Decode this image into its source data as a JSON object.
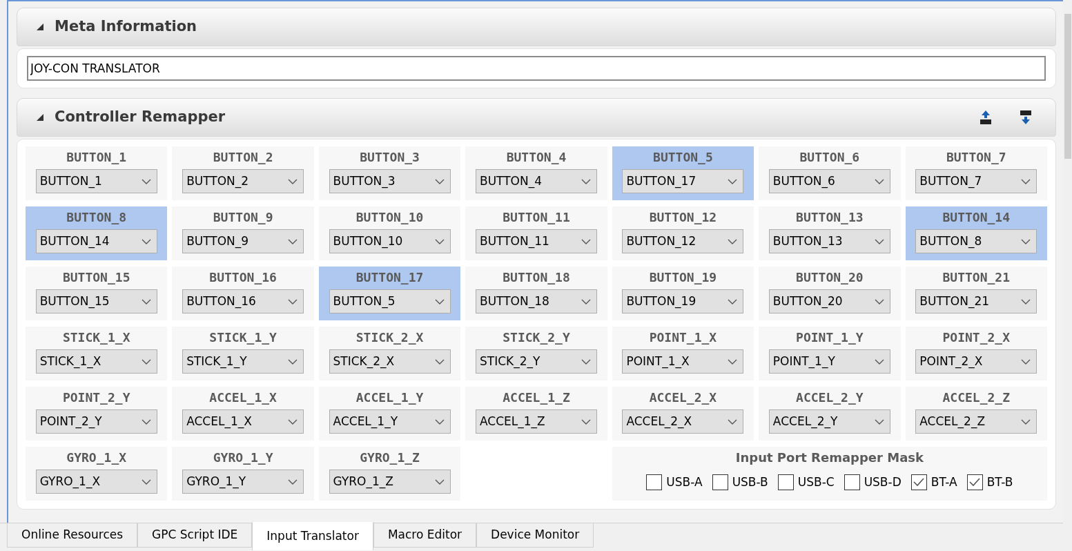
{
  "sections": [
    {
      "title": "Meta Information",
      "expanded": true
    },
    {
      "title": "Controller Remapper",
      "expanded": true
    }
  ],
  "meta": {
    "value": "JOY-CON TRANSLATOR"
  },
  "mappings": [
    {
      "label": "BUTTON_1",
      "value": "BUTTON_1",
      "highlighted": false
    },
    {
      "label": "BUTTON_2",
      "value": "BUTTON_2",
      "highlighted": false
    },
    {
      "label": "BUTTON_3",
      "value": "BUTTON_3",
      "highlighted": false
    },
    {
      "label": "BUTTON_4",
      "value": "BUTTON_4",
      "highlighted": false
    },
    {
      "label": "BUTTON_5",
      "value": "BUTTON_17",
      "highlighted": true
    },
    {
      "label": "BUTTON_6",
      "value": "BUTTON_6",
      "highlighted": false
    },
    {
      "label": "BUTTON_7",
      "value": "BUTTON_7",
      "highlighted": false
    },
    {
      "label": "BUTTON_8",
      "value": "BUTTON_14",
      "highlighted": true
    },
    {
      "label": "BUTTON_9",
      "value": "BUTTON_9",
      "highlighted": false
    },
    {
      "label": "BUTTON_10",
      "value": "BUTTON_10",
      "highlighted": false
    },
    {
      "label": "BUTTON_11",
      "value": "BUTTON_11",
      "highlighted": false
    },
    {
      "label": "BUTTON_12",
      "value": "BUTTON_12",
      "highlighted": false
    },
    {
      "label": "BUTTON_13",
      "value": "BUTTON_13",
      "highlighted": false
    },
    {
      "label": "BUTTON_14",
      "value": "BUTTON_8",
      "highlighted": true
    },
    {
      "label": "BUTTON_15",
      "value": "BUTTON_15",
      "highlighted": false
    },
    {
      "label": "BUTTON_16",
      "value": "BUTTON_16",
      "highlighted": false
    },
    {
      "label": "BUTTON_17",
      "value": "BUTTON_5",
      "highlighted": true
    },
    {
      "label": "BUTTON_18",
      "value": "BUTTON_18",
      "highlighted": false
    },
    {
      "label": "BUTTON_19",
      "value": "BUTTON_19",
      "highlighted": false
    },
    {
      "label": "BUTTON_20",
      "value": "BUTTON_20",
      "highlighted": false
    },
    {
      "label": "BUTTON_21",
      "value": "BUTTON_21",
      "highlighted": false
    },
    {
      "label": "STICK_1_X",
      "value": "STICK_1_X",
      "highlighted": false
    },
    {
      "label": "STICK_1_Y",
      "value": "STICK_1_Y",
      "highlighted": false
    },
    {
      "label": "STICK_2_X",
      "value": "STICK_2_X",
      "highlighted": false
    },
    {
      "label": "STICK_2_Y",
      "value": "STICK_2_Y",
      "highlighted": false
    },
    {
      "label": "POINT_1_X",
      "value": "POINT_1_X",
      "highlighted": false
    },
    {
      "label": "POINT_1_Y",
      "value": "POINT_1_Y",
      "highlighted": false
    },
    {
      "label": "POINT_2_X",
      "value": "POINT_2_X",
      "highlighted": false
    },
    {
      "label": "POINT_2_Y",
      "value": "POINT_2_Y",
      "highlighted": false
    },
    {
      "label": "ACCEL_1_X",
      "value": "ACCEL_1_X",
      "highlighted": false
    },
    {
      "label": "ACCEL_1_Y",
      "value": "ACCEL_1_Y",
      "highlighted": false
    },
    {
      "label": "ACCEL_1_Z",
      "value": "ACCEL_1_Z",
      "highlighted": false
    },
    {
      "label": "ACCEL_2_X",
      "value": "ACCEL_2_X",
      "highlighted": false
    },
    {
      "label": "ACCEL_2_Y",
      "value": "ACCEL_2_Y",
      "highlighted": false
    },
    {
      "label": "ACCEL_2_Z",
      "value": "ACCEL_2_Z",
      "highlighted": false
    },
    {
      "label": "GYRO_1_X",
      "value": "GYRO_1_X",
      "highlighted": false
    },
    {
      "label": "GYRO_1_Y",
      "value": "GYRO_1_Y",
      "highlighted": false
    },
    {
      "label": "GYRO_1_Z",
      "value": "GYRO_1_Z",
      "highlighted": false
    }
  ],
  "port_mask": {
    "title": "Input Port Remapper Mask",
    "ports": [
      {
        "label": "USB-A",
        "checked": false
      },
      {
        "label": "USB-B",
        "checked": false
      },
      {
        "label": "USB-C",
        "checked": false
      },
      {
        "label": "USB-D",
        "checked": false
      },
      {
        "label": "BT-A",
        "checked": true
      },
      {
        "label": "BT-B",
        "checked": true
      }
    ]
  },
  "tabs": [
    {
      "label": "Online Resources",
      "selected": false
    },
    {
      "label": "GPC Script IDE",
      "selected": false
    },
    {
      "label": "Input Translator",
      "selected": true
    },
    {
      "label": "Macro Editor",
      "selected": false
    },
    {
      "label": "Device Monitor",
      "selected": false
    }
  ]
}
